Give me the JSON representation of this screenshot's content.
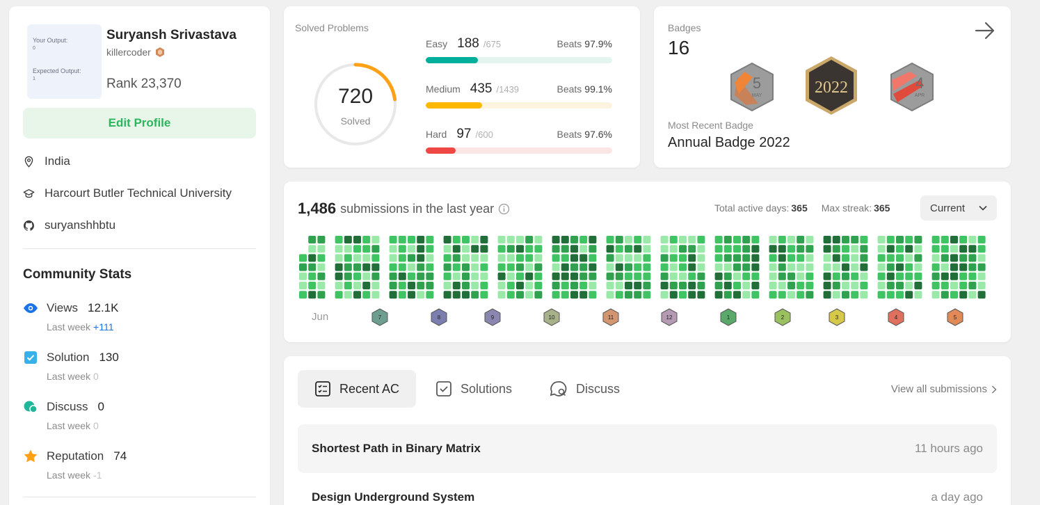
{
  "profile": {
    "avatar_line1": "Your Output:",
    "avatar_line2": "0",
    "avatar_line3": "Expected Output:",
    "avatar_line4": "1",
    "name": "Suryansh Srivastava",
    "username": "killercoder",
    "rank_label": "Rank",
    "rank_value": "23,370",
    "edit_label": "Edit Profile",
    "location": "India",
    "school": "Harcourt Butler Technical University",
    "github": "suryanshhbtu"
  },
  "community": {
    "title": "Community Stats",
    "stats": [
      {
        "label": "Views",
        "value": "12.1K",
        "sub_label": "Last week",
        "delta": "+111",
        "delta_color": "#1a73e8",
        "icon": "eye-icon",
        "color": "#1a73e8"
      },
      {
        "label": "Solution",
        "value": "130",
        "sub_label": "Last week",
        "delta": "0",
        "delta_color": "#c0c0c0",
        "icon": "check-square-icon",
        "color": "#38b0ea"
      },
      {
        "label": "Discuss",
        "value": "0",
        "sub_label": "Last week",
        "delta": "0",
        "delta_color": "#c0c0c0",
        "icon": "chat-bubbles-icon",
        "color": "#20b69a"
      },
      {
        "label": "Reputation",
        "value": "74",
        "sub_label": "Last week",
        "delta": "-1",
        "delta_color": "#c0c0c0",
        "icon": "star-icon",
        "color": "#ffa116"
      }
    ]
  },
  "solved": {
    "title": "Solved Problems",
    "total": "720",
    "total_label": "Solved",
    "progress": 0.23,
    "difficulties": [
      {
        "name": "Easy",
        "count": "188",
        "total": "/675",
        "beats_label": "Beats",
        "beats": "97.9%",
        "fraction": 0.2785,
        "color": "#00af9b",
        "track": "#e4f5f0"
      },
      {
        "name": "Medium",
        "count": "435",
        "total": "/1439",
        "beats_label": "Beats",
        "beats": "99.1%",
        "fraction": 0.3023,
        "color": "#ffb800",
        "track": "#fdf4e0"
      },
      {
        "name": "Hard",
        "count": "97",
        "total": "/600",
        "beats_label": "Beats",
        "beats": "97.6%",
        "fraction": 0.1617,
        "color": "#ef4743",
        "track": "#fbe6e5"
      }
    ]
  },
  "badges": {
    "label": "Badges",
    "count": "16",
    "recent_label": "Most Recent Badge",
    "recent_name": "Annual Badge 2022",
    "items": [
      {
        "text": "5",
        "sub": "MAY"
      },
      {
        "text": "2022",
        "sub": ""
      },
      {
        "text": "4",
        "sub": "APR"
      }
    ]
  },
  "submissions": {
    "count": "1,486",
    "text": "submissions in the last year",
    "active_label": "Total active days:",
    "active_value": "365",
    "streak_label": "Max streak:",
    "streak_value": "365",
    "period": "Current",
    "first_month": "Jun",
    "month_badges": [
      "7",
      "8",
      "9",
      "10",
      "11",
      "12",
      "1",
      "2",
      "3",
      "4",
      "5"
    ]
  },
  "recent": {
    "tabs": [
      {
        "label": "Recent AC",
        "icon": "list-check-icon",
        "active": true
      },
      {
        "label": "Solutions",
        "icon": "check-box-icon",
        "active": false
      },
      {
        "label": "Discuss",
        "icon": "chat-search-icon",
        "active": false
      }
    ],
    "view_all": "View all submissions",
    "items": [
      {
        "title": "Shortest Path in Binary Matrix",
        "ago": "11 hours ago"
      },
      {
        "title": "Design Underground System",
        "ago": "a day ago"
      }
    ]
  }
}
